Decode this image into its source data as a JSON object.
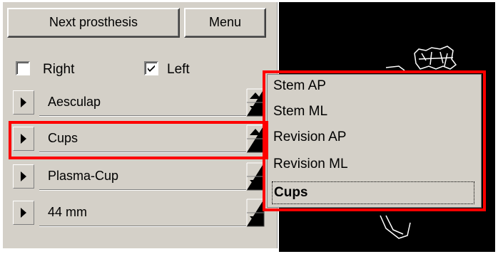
{
  "toolbar": {
    "next_prosthesis_label": "Next prosthesis",
    "menu_label": "Menu"
  },
  "side": {
    "right_label": "Right",
    "right_checked": false,
    "left_label": "Left",
    "left_checked": true
  },
  "selectors": [
    {
      "value": "Aesculap"
    },
    {
      "value": "Cups"
    },
    {
      "value": "Plasma-Cup"
    },
    {
      "value": "44 mm"
    }
  ],
  "dropdown": {
    "items": [
      "Stem AP",
      "Stem ML",
      "Revision AP",
      "Revision ML",
      "Cups"
    ],
    "selected": "Cups"
  },
  "colors": {
    "panel": "#d4d0c8",
    "highlight": "#ff0000",
    "viewer_background": "#000000"
  }
}
